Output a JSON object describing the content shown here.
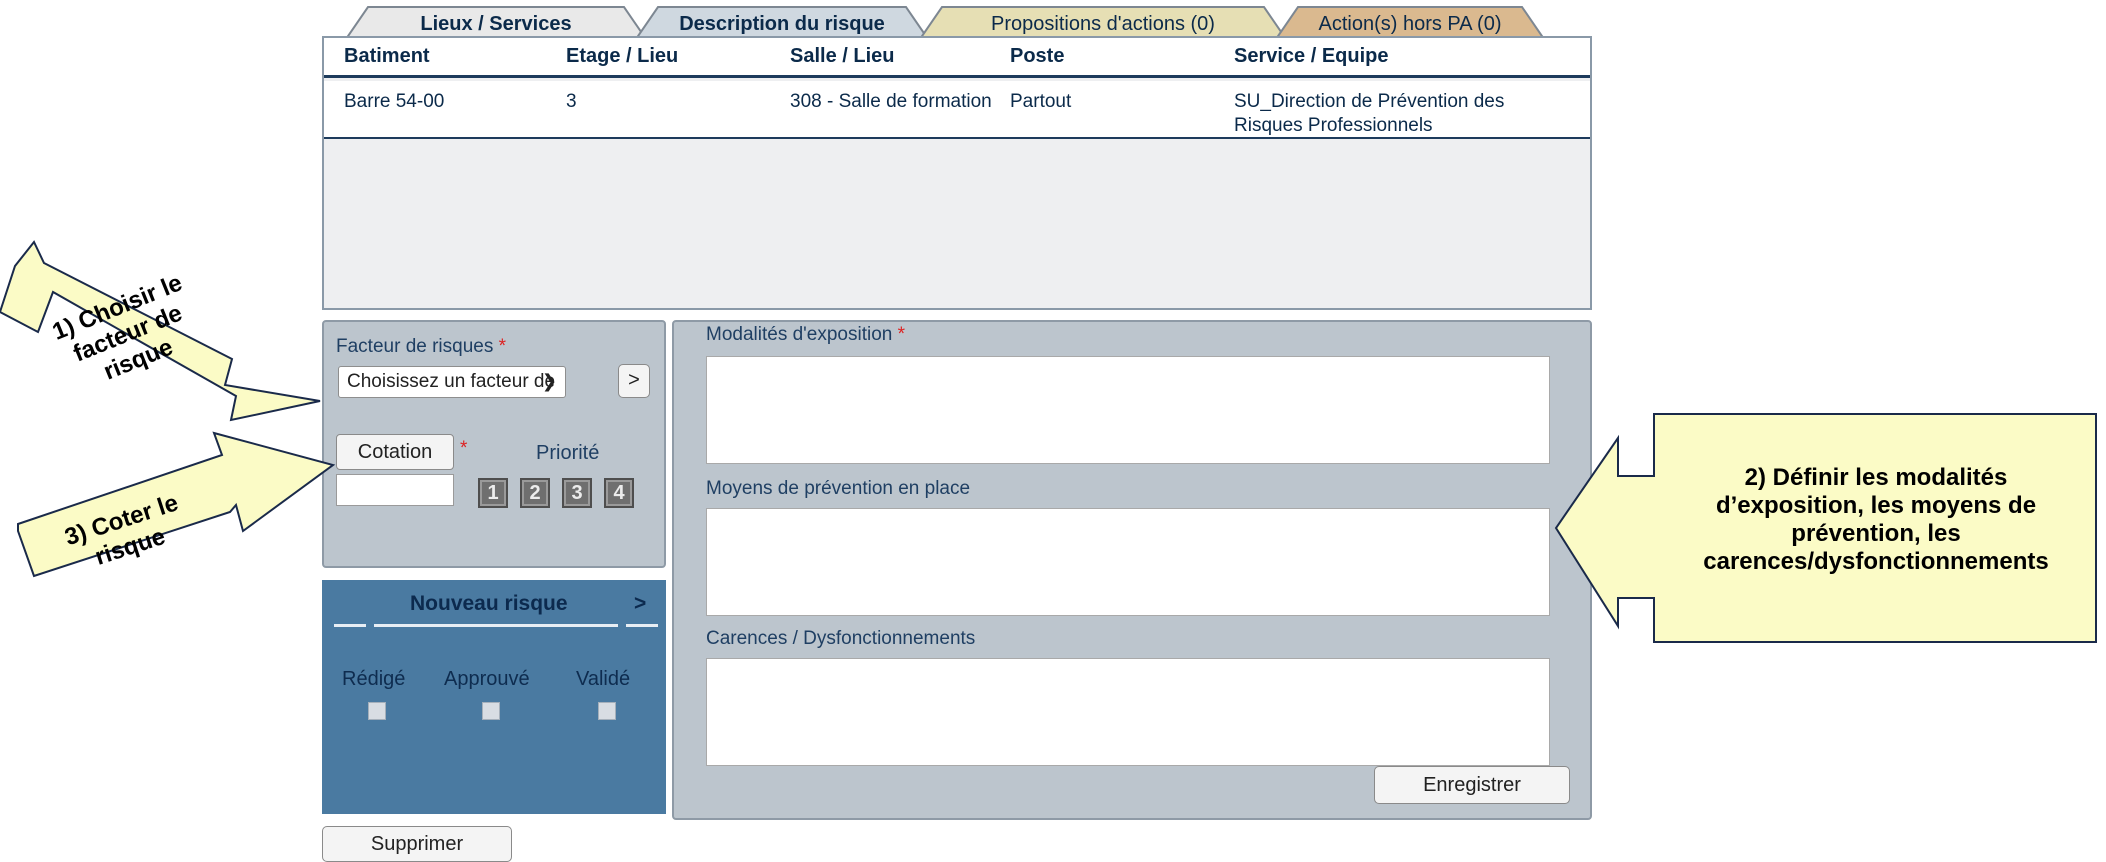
{
  "tabs": [
    {
      "label": "Lieux / Services",
      "color": "#e9e9e9",
      "bold": true
    },
    {
      "label": "Description du risque",
      "color": "#cfd8e0",
      "bold": true
    },
    {
      "label": "Propositions d'actions (0)",
      "color": "#e6dfb4",
      "bold": false
    },
    {
      "label": "Action(s) hors PA (0)",
      "color": "#dab98f",
      "bold": false
    }
  ],
  "table": {
    "headers": [
      "Batiment",
      "Etage / Lieu",
      "Salle / Lieu",
      "Poste",
      "Service / Equipe"
    ],
    "rows": [
      {
        "batiment": "Barre 54-00",
        "etage": "3",
        "salle": "308 - Salle de formation",
        "poste": "Partout",
        "service_line1": "SU_Direction de Prévention des",
        "service_line2": "Risques Professionnels"
      }
    ]
  },
  "risk_form": {
    "factor_label": "Facteur de risques",
    "required_mark": "*",
    "factor_select_value": "Choisissez un facteur de",
    "go_button": ">",
    "cotation_button": "Cotation",
    "priority_label": "Priorité",
    "priorities": [
      "1",
      "2",
      "3",
      "4"
    ]
  },
  "new_risk": {
    "title": "Nouveau risque",
    "arrow": ">",
    "statuses": [
      "Rédigé",
      "Approuvé",
      "Validé"
    ]
  },
  "details": {
    "exposure_label": "Modalités d'exposition",
    "prevention_label": "Moyens de prévention en place",
    "deficiency_label": "Carences / Dysfonctionnements",
    "save_button": "Enregistrer"
  },
  "delete_button": "Supprimer",
  "callouts": {
    "step1_lines": [
      "1) Choisir le",
      "facteur de",
      "risque"
    ],
    "step2_lines": [
      "2) Définir les modalités",
      "d’exposition, les moyens de",
      "prévention, les",
      "carences/dysfonctionnements"
    ],
    "step3_lines": [
      "3) Coter le",
      "risque"
    ]
  },
  "colors": {
    "callout_fill": "#fbfbc6",
    "panel_grey": "#bcc5cd",
    "panel_blue": "#4a7aa1"
  }
}
